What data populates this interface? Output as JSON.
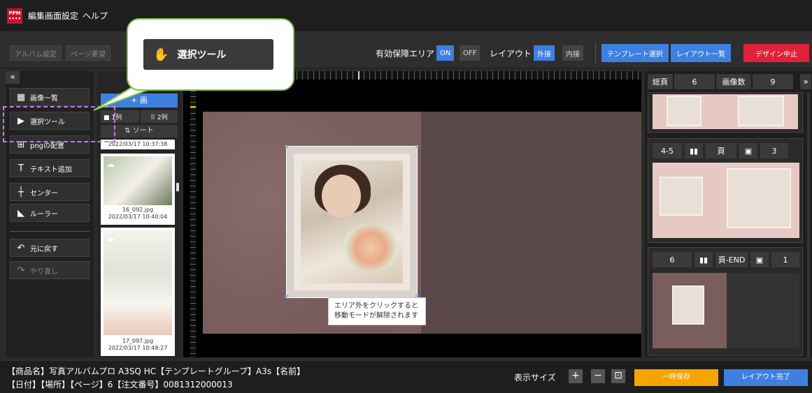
{
  "app": {
    "logo_text_top": "PPM",
    "logo_text_bottom": "••••",
    "menu1": "編集画面設定",
    "menu2": "ヘルプ"
  },
  "toolbar": {
    "album_settings": "アルバム設定",
    "page_request": "ページ要望",
    "valid_area_label": "有効保障エリア",
    "on": "ON",
    "off": "OFF",
    "layout_label": "レイアウト",
    "outer": "外接",
    "inner": "内接",
    "template_select": "テンプレート選択",
    "layout_list": "レイアウト一覧",
    "design_stop": "デザイン中止"
  },
  "left_tools": {
    "collapse": "«",
    "items": [
      {
        "icon": "▦",
        "label": "画像一覧"
      },
      {
        "icon": "▶",
        "label": "選択ツール"
      },
      {
        "icon": "⊞",
        "label": "pngの配置"
      },
      {
        "icon": "T",
        "label": "テキスト追加"
      },
      {
        "icon": "┼",
        "label": "センター"
      },
      {
        "icon": "◣",
        "label": "ルーラー"
      },
      {
        "icon": "↶",
        "label": "元に戻す"
      },
      {
        "icon": "↷",
        "label": "やり直し"
      }
    ]
  },
  "image_column": {
    "header": "画",
    "add_label": "+ 画",
    "one_col": "■ 1列",
    "two_col": "⠿ 2列",
    "sort": "⇅ ソート",
    "top_date": "2022/03/17 10:37:38",
    "images": [
      {
        "name": "16_092.jpg",
        "date": "2022/03/17 10:40:04"
      },
      {
        "name": "17_097.jpg",
        "date": "2022/03/17 10:48:27"
      }
    ]
  },
  "canvas": {
    "tooltip_line1": "エリア外をクリックすると",
    "tooltip_line2": "移動モードが解除されます"
  },
  "right_panel": {
    "total_pages_label": "総頁",
    "total_pages": "6",
    "image_count_label": "画像数",
    "image_count": "9",
    "expand": "»",
    "pages": [
      {
        "range": "4-5",
        "page_label": "頁",
        "count": "3"
      },
      {
        "range": "6",
        "page_label": "頁-END",
        "count": "1"
      }
    ]
  },
  "footer": {
    "product_info": "【商品名】写真アルバムプロ A3SQ HC【テンプレートグループ】A3s【名前】",
    "order_info": "【日付】【場所】【ページ】6【注文番号】0081312000013",
    "zoom_label": "表示サイズ",
    "zoom_in": "+",
    "zoom_out": "−",
    "fit": "⊡",
    "temp_save": "一時保存",
    "layout_done": "レイアウト完了"
  },
  "callout": {
    "label": "選択ツール",
    "icon": "hand-icon"
  },
  "colors": {
    "accent_blue": "#3f7fe0",
    "danger_red": "#e0213a",
    "save_orange": "#f5a300",
    "callout_green": "#7ec24a",
    "highlight_purple": "#c878e8"
  }
}
